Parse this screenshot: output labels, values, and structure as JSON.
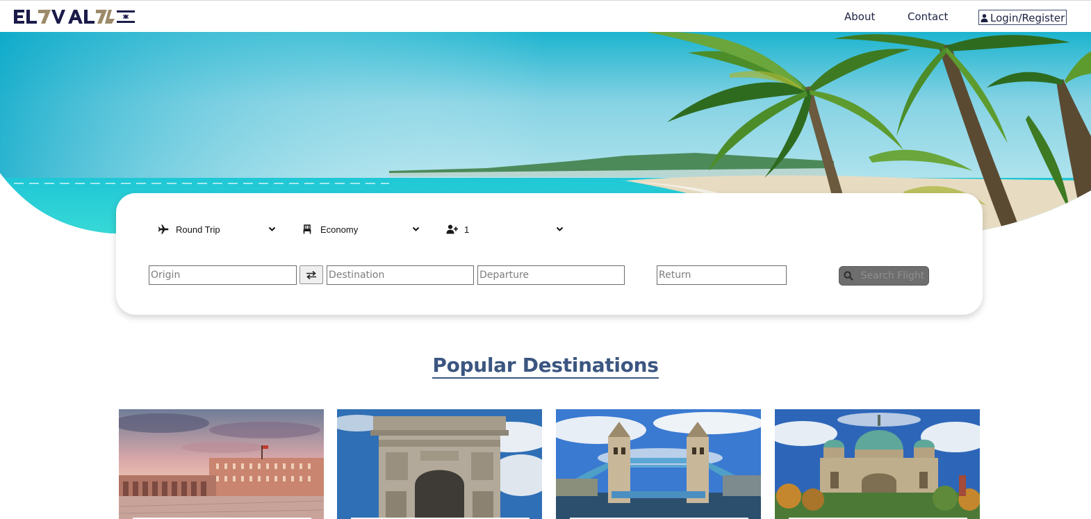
{
  "header": {
    "logo_text": "EL AL",
    "nav": {
      "about": "About",
      "contact": "Contact",
      "login": "Login/Register"
    },
    "icons": {
      "login": "user-icon"
    }
  },
  "search": {
    "trip_type": {
      "selected": "Round Trip",
      "icon": "airplane-icon"
    },
    "cabin_class": {
      "selected": "Economy",
      "icon": "seat-icon"
    },
    "passengers": {
      "selected": "1",
      "icon": "user-plus-icon"
    },
    "origin": {
      "placeholder": "Origin",
      "value": ""
    },
    "destination": {
      "placeholder": "Destination",
      "value": ""
    },
    "departure": {
      "placeholder": "Departure",
      "value": ""
    },
    "return": {
      "placeholder": "Return",
      "value": ""
    },
    "swap_icon": "swap-arrows-icon",
    "submit_label": "Search Flight",
    "submit_icon": "search-icon"
  },
  "popular": {
    "title": "Popular Destinations",
    "destinations": [
      {
        "image": "royal-palace-image"
      },
      {
        "image": "triumphal-arch-image"
      },
      {
        "image": "tower-bridge-image"
      },
      {
        "image": "cathedral-dome-image"
      }
    ]
  },
  "colors": {
    "brand_navy": "#1b1b4a",
    "brand_gold": "#9c8a6a",
    "title_blue": "#3b5680",
    "search_button": "#6e6e6e"
  }
}
